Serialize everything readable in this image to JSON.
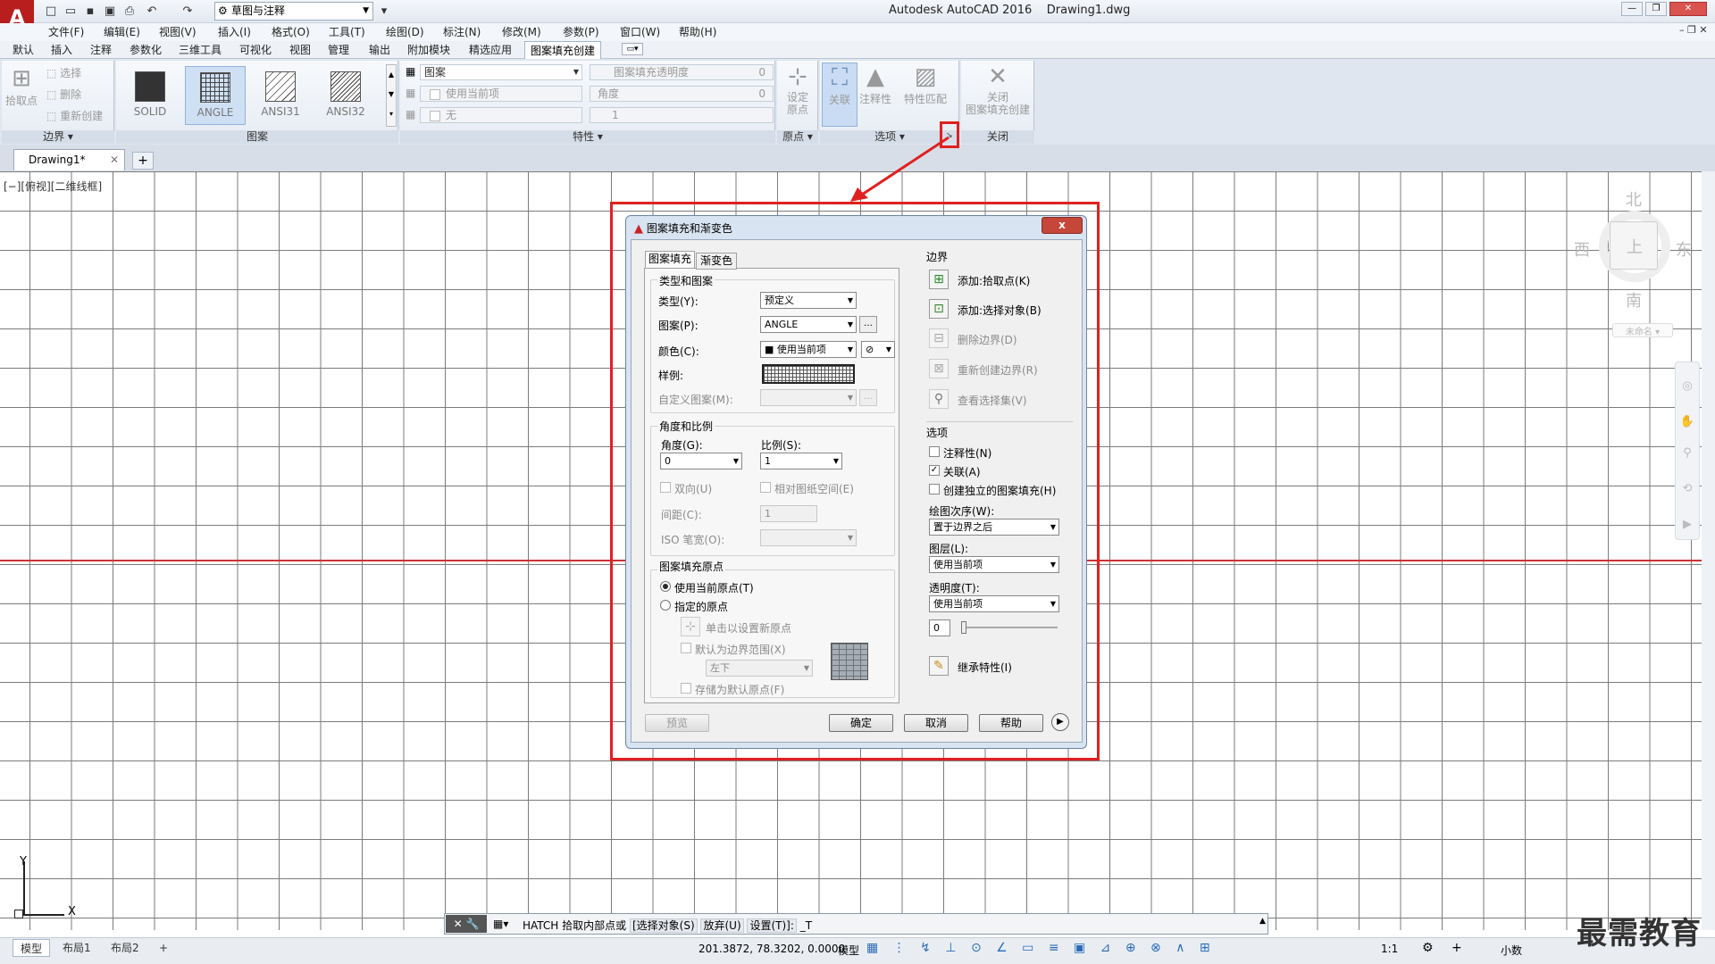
{
  "app": {
    "title": "Autodesk AutoCAD 2016",
    "filename": "Drawing1.dwg",
    "logo": "A",
    "workspace": "草图与注释"
  },
  "menubar": [
    "文件(F)",
    "编辑(E)",
    "视图(V)",
    "插入(I)",
    "格式(O)",
    "工具(T)",
    "绘图(D)",
    "标注(N)",
    "修改(M)",
    "参数(P)",
    "窗口(W)",
    "帮助(H)"
  ],
  "ribbon_tabs": [
    "默认",
    "插入",
    "注释",
    "参数化",
    "三维工具",
    "可视化",
    "视图",
    "管理",
    "输出",
    "附加模块",
    "精选应用",
    "图案填充创建"
  ],
  "ribbon": {
    "boundary": {
      "pick_points": "拾取点",
      "select": "选择",
      "remove": "删除",
      "recreate": "重新创建",
      "title": "边界"
    },
    "pattern": {
      "tiles": [
        "SOLID",
        "ANGLE",
        "ANSI31",
        "ANSI32"
      ],
      "title": "图案"
    },
    "properties": {
      "type": "图案",
      "color": "使用当前项",
      "background": "无",
      "transparency_label": "图案填充透明度",
      "transparency": "0",
      "angle_label": "角度",
      "angle": "0",
      "scale": "1",
      "title": "特性"
    },
    "origin": {
      "set_origin": "设定\n原点",
      "title": "原点"
    },
    "options": {
      "associative": "关联",
      "annotative": "注释性",
      "match": "特性匹配",
      "title": "选项"
    },
    "close": {
      "close": "关闭\n图案填充创建",
      "title": "关闭"
    }
  },
  "file_tab": {
    "name": "Drawing1*"
  },
  "viewport_label": "[−][俯视][二维线框]",
  "viewcube": {
    "north": "北",
    "south": "南",
    "east": "东",
    "west": "西",
    "top": "上",
    "wcs": "未命名"
  },
  "dialog": {
    "title": "图案填充和渐变色",
    "close": "x",
    "tabs": [
      "图案填充",
      "渐变色"
    ],
    "type_pattern": {
      "group": "类型和图案",
      "type_label": "类型(Y):",
      "type_value": "预定义",
      "pattern_label": "图案(P):",
      "pattern_value": "ANGLE",
      "color_label": "颜色(C):",
      "color_value": "使用当前项",
      "swatch_label": "样例:",
      "custom_label": "自定义图案(M):"
    },
    "angle_scale": {
      "group": "角度和比例",
      "angle_label": "角度(G):",
      "angle_value": "0",
      "scale_label": "比例(S):",
      "scale_value": "1",
      "double_label": "双向(U)",
      "relative_label": "相对图纸空间(E)",
      "spacing_label": "间距(C):",
      "spacing_value": "1",
      "iso_label": "ISO 笔宽(O):"
    },
    "origin": {
      "group": "图案填充原点",
      "use_current": "使用当前原点(T)",
      "specified": "指定的原点",
      "click_set": "单击以设置新原点",
      "default_extents": "默认为边界范围(X)",
      "position": "左下",
      "store_default": "存储为默认原点(F)"
    },
    "boundary": {
      "group": "边界",
      "add_pick": "添加:拾取点(K)",
      "add_select": "添加:选择对象(B)",
      "remove": "删除边界(D)",
      "recreate": "重新创建边界(R)",
      "view": "查看选择集(V)"
    },
    "options": {
      "group": "选项",
      "annotative": "注释性(N)",
      "associative": "关联(A)",
      "separate": "创建独立的图案填充(H)",
      "draw_order_label": "绘图次序(W):",
      "draw_order": "置于边界之后",
      "layer_label": "图层(L):",
      "layer": "使用当前项",
      "transparency_label": "透明度(T):",
      "transparency": "使用当前项",
      "transparency_value": "0"
    },
    "inherit": "继承特性(I)",
    "buttons": {
      "preview": "预览",
      "ok": "确定",
      "cancel": "取消",
      "help": "帮助"
    }
  },
  "command_line": {
    "text": "HATCH 拾取内部点或",
    "opt1": "[选择对象(S)",
    "opt2": "放弃(U)",
    "opt3": "设置(T)]:",
    "input": "_T"
  },
  "layout_tabs": [
    "模型",
    "布局1",
    "布局2"
  ],
  "status": {
    "coords": "201.3872, 78.3202, 0.0000",
    "model": "模型",
    "scale": "1:1",
    "units": "小数"
  },
  "watermark": "最需教育"
}
